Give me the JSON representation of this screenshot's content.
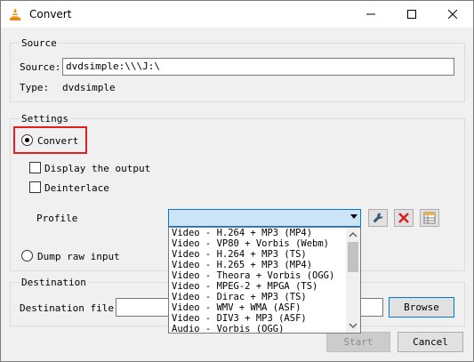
{
  "window": {
    "title": "Convert"
  },
  "source": {
    "group_label": "Source",
    "source_label": "Source:",
    "source_value": "dvdsimple:\\\\\\J:\\",
    "type_label": "Type:",
    "type_value": "dvdsimple"
  },
  "settings": {
    "group_label": "Settings",
    "convert_label": "Convert",
    "display_output_label": "Display the output",
    "deinterlace_label": "Deinterlace",
    "profile_label": "Profile",
    "profile_selected": "",
    "dump_raw_label": "Dump raw input",
    "profile_options": [
      "Video - H.264 + MP3 (MP4)",
      "Video - VP80 + Vorbis (Webm)",
      "Video - H.264 + MP3 (TS)",
      "Video - H.265 + MP3 (MP4)",
      "Video - Theora + Vorbis (OGG)",
      "Video - MPEG-2 + MPGA (TS)",
      "Video - Dirac + MP3 (TS)",
      "Video - WMV + WMA (ASF)",
      "Video - DIV3 + MP3 (ASF)",
      "Audio - Vorbis (OGG)"
    ]
  },
  "destination": {
    "group_label": "Destination",
    "file_label": "Destination file:",
    "file_value": "",
    "browse_label": "Browse"
  },
  "footer": {
    "start_label": "Start",
    "cancel_label": "Cancel"
  },
  "colors": {
    "highlight": "#e02020",
    "selection": "#cce4f7",
    "accent": "#0078d7"
  }
}
